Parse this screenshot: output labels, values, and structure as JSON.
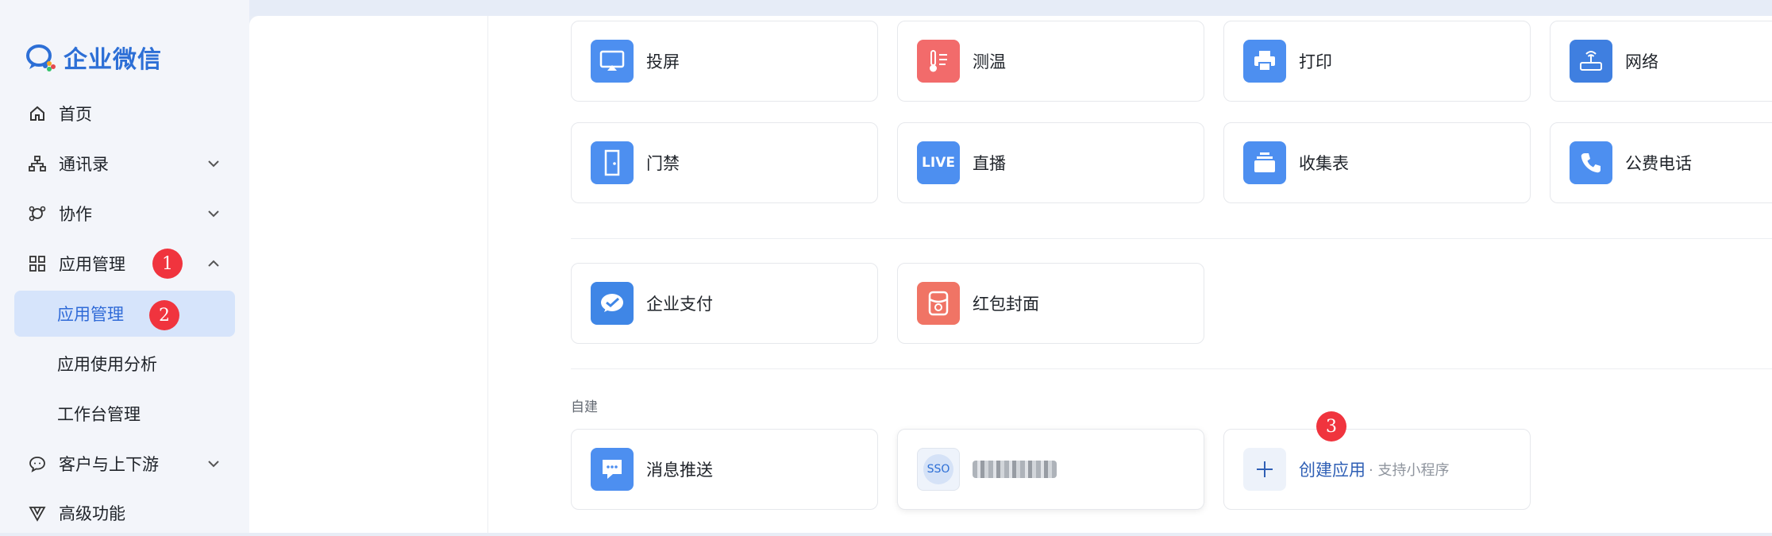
{
  "brand": {
    "name": "企业微信"
  },
  "sidebar": {
    "items": [
      {
        "label": "首页",
        "icon": "home-icon"
      },
      {
        "label": "通讯录",
        "icon": "org-chart-icon"
      },
      {
        "label": "协作",
        "icon": "collab-icon"
      },
      {
        "label": "应用管理",
        "icon": "apps-grid-icon"
      },
      {
        "label": "客户与上下游",
        "icon": "chat-bubble-icon"
      },
      {
        "label": "高级功能",
        "icon": "diamond-icon"
      }
    ],
    "subitems": [
      {
        "label": "应用管理",
        "active": true
      },
      {
        "label": "应用使用分析"
      },
      {
        "label": "工作台管理"
      }
    ]
  },
  "annotations": [
    "1",
    "2",
    "3"
  ],
  "apps": {
    "row1": [
      {
        "label": "投屏",
        "color": "#4d8ff0"
      },
      {
        "label": "测温",
        "color": "#f26b6b"
      },
      {
        "label": "打印",
        "color": "#4d8ff0"
      },
      {
        "label": "网络",
        "color": "#3f7fe0"
      }
    ],
    "row2": [
      {
        "label": "门禁",
        "color": "#4d8ff0"
      },
      {
        "label": "直播",
        "color": "#4d8ff0",
        "icon_text": "LIVE"
      },
      {
        "label": "收集表",
        "color": "#4d8ff0"
      },
      {
        "label": "公费电话",
        "color": "#4d8ff0"
      }
    ],
    "row3": [
      {
        "label": "企业支付",
        "color": "#3f86e6"
      },
      {
        "label": "红包封面",
        "color": "#f07465"
      }
    ]
  },
  "custom": {
    "section_label": "自建",
    "items": [
      {
        "label": "消息推送",
        "color": "#4d8ff0"
      },
      {
        "label": "",
        "icon_text": "SSO"
      }
    ],
    "create": {
      "label": "创建应用",
      "sub": "· 支持小程序"
    }
  }
}
